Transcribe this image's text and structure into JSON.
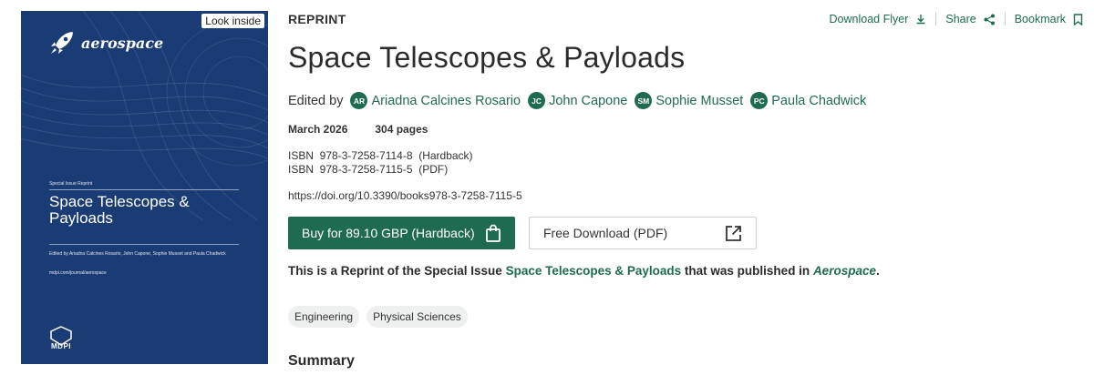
{
  "cover": {
    "look_inside": "Look inside",
    "journal": "aerospace",
    "special_issue_label": "Special Issue Reprint",
    "title": "Space Telescopes & Payloads",
    "edited_by": "Edited by Ariadna Calcines Rosario, John Capone, Sophie Musset and Paula Chadwick",
    "url": "mdpi.com/journal/aerospace",
    "publisher": "MDPI",
    "bg_color": "#1a3b73"
  },
  "header": {
    "label": "REPRINT",
    "actions": {
      "download_flyer": "Download Flyer",
      "share": "Share",
      "bookmark": "Bookmark"
    }
  },
  "book": {
    "title": "Space Telescopes & Payloads",
    "edited_by_label": "Edited by",
    "editors": [
      {
        "initials": "AR",
        "name": "Ariadna Calcines Rosario"
      },
      {
        "initials": "JC",
        "name": "John Capone"
      },
      {
        "initials": "SM",
        "name": "Sophie Musset"
      },
      {
        "initials": "PC",
        "name": "Paula Chadwick"
      }
    ],
    "date": "March 2026",
    "pages": "304 pages",
    "isbn": [
      "ISBN  978-3-7258-7114-8  (Hardback)",
      "ISBN  978-3-7258-7115-5  (PDF)"
    ],
    "doi": "https://doi.org/10.3390/books978-3-7258-7115-5"
  },
  "buttons": {
    "buy": "Buy for 89.10 GBP (Hardback)",
    "free_download": "Free Download (PDF)"
  },
  "special_issue": {
    "prefix": "This is a Reprint of the Special Issue ",
    "link": "Space Telescopes & Payloads",
    "middle": " that was published in ",
    "journal": "Aerospace",
    "suffix": "."
  },
  "subjects": [
    "Engineering",
    "Physical Sciences"
  ],
  "summary_heading": "Summary",
  "colors": {
    "accent": "#1f6b52",
    "cover": "#1a3b73"
  }
}
